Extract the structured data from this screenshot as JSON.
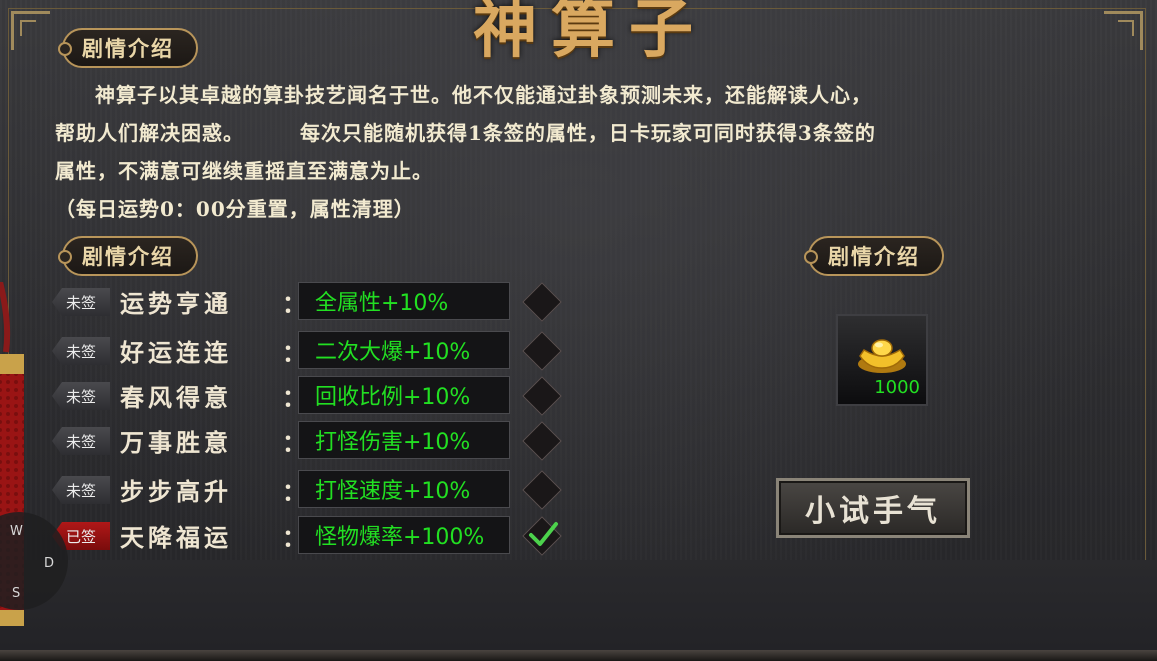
{
  "window": {
    "title": "神算子"
  },
  "sections": {
    "story": "剧情介绍",
    "attributes": "剧情介绍",
    "reward": "剧情介绍"
  },
  "description": {
    "line1": "神算子以其卓越的算卦技艺闻名于世。他不仅能通过卦象预测未来，还能解读人心，",
    "line2a": "帮助人们解决困惑。",
    "line2b": "每次只能随机获得1条签的属性，日卡玩家可同时获得3条签的",
    "line3": "属性，不满意可继续重摇直至满意为止。",
    "line4": "（每日运势0：00分重置，属性清理）"
  },
  "fortunes": [
    {
      "status": "未签",
      "name": "运势亨通",
      "attribute": "全属性+10%",
      "signed": false
    },
    {
      "status": "未签",
      "name": "好运连连",
      "attribute": "二次大爆+10%",
      "signed": false
    },
    {
      "status": "未签",
      "name": "春风得意",
      "attribute": "回收比例+10%",
      "signed": false
    },
    {
      "status": "未签",
      "name": "万事胜意",
      "attribute": "打怪伤害+10%",
      "signed": false
    },
    {
      "status": "未签",
      "name": "步步高升",
      "attribute": "打怪速度+10%",
      "signed": false
    },
    {
      "status": "已签",
      "name": "天降福运",
      "attribute": "怪物爆率+100%",
      "signed": true
    }
  ],
  "colon": "：",
  "reward": {
    "icon": "gold-ingot-icon",
    "count": "1000"
  },
  "try_button": "小试手气",
  "joystick": {
    "up": "W",
    "right": "D",
    "down": "S"
  },
  "colors": {
    "attribute_text": "#22e022",
    "signed_tag": "#b01818",
    "gold": "#d9a860"
  }
}
